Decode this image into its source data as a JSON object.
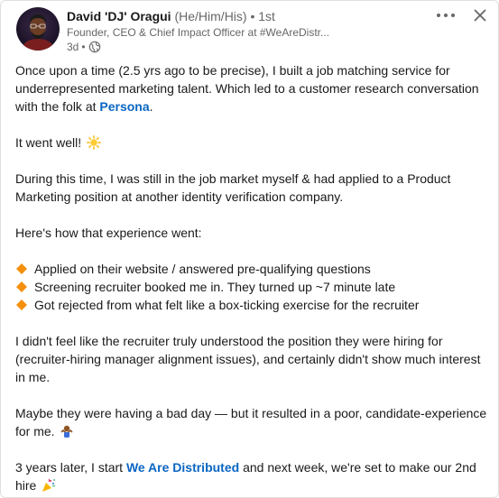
{
  "author": {
    "name": "David 'DJ' Oragui",
    "pronouns": "(He/Him/His)",
    "separator": "•",
    "degree": "1st",
    "headline": "Founder, CEO & Chief Impact Officer at #WeAreDistr...",
    "time": "3d",
    "meta_separator": "•",
    "visibility_icon": "globe-icon"
  },
  "actions": {
    "more_icon": "more-horizontal-icon",
    "close_icon": "close-icon"
  },
  "post": {
    "p1_a": "Once upon a time (2.5 yrs ago to be precise), I built a job matching service for underrepresented marketing talent. Which led to a customer research conversation with the folk at ",
    "p1_link": "Persona",
    "p1_b": ".",
    "p2": "It went well!",
    "p2_emoji": "sun-emoji",
    "p3": "During this time, I was still in the job market myself & had applied to a Product Marketing position at another identity verification company.",
    "p4": "Here's how that experience went:",
    "bullets": [
      "Applied on their website / answered pre-qualifying questions",
      "Screening recruiter booked me in. They turned up ~7 minute late",
      "Got rejected from what felt like a box-ticking exercise for the recruiter"
    ],
    "bullet_icon": "orange-diamond-icon",
    "p5": "I didn't feel like the recruiter truly understood the position they were hiring for (recruiter-hiring manager alignment issues), and certainly didn't show much interest in me.",
    "p6": "Maybe they were having a bad day — but it resulted in a poor, candidate-experience for me.",
    "p6_emoji": "shrug-emoji",
    "p7_a": "3 years later, I start ",
    "p7_link": "We Are Distributed",
    "p7_b": " and next week, we're set to make our 2nd hire",
    "p7_emoji": "party-popper-emoji"
  },
  "colors": {
    "link": "#0a66c2",
    "text": "#191919",
    "muted": "#666666",
    "bullet": "#f4900c"
  }
}
